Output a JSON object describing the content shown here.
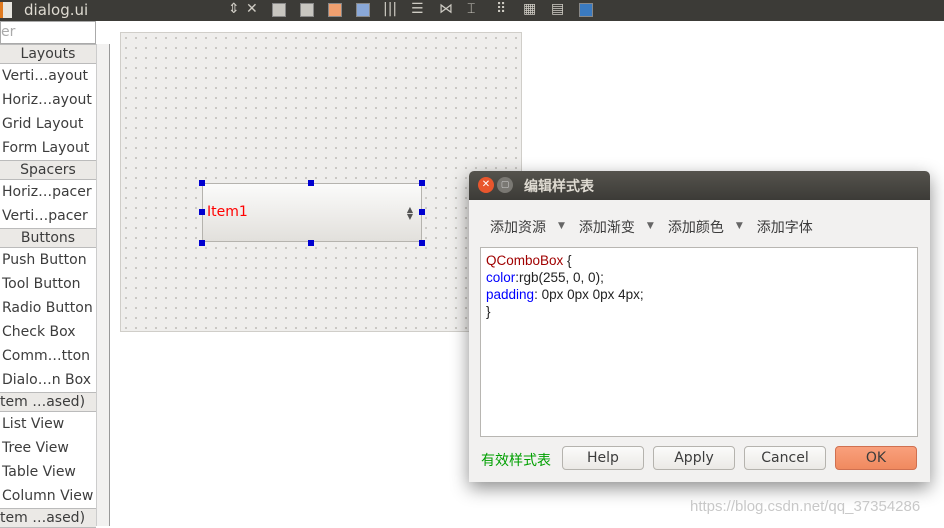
{
  "window": {
    "title": "dialog.ui"
  },
  "widget_box": {
    "filter_placeholder": "er",
    "sections": [
      {
        "header": "Layouts",
        "items": [
          "Verti…ayout",
          "Horiz…ayout",
          "Grid Layout",
          "Form Layout"
        ]
      },
      {
        "header": "Spacers",
        "items": [
          "Horiz…pacer",
          "Verti…pacer"
        ]
      },
      {
        "header": "Buttons",
        "items": [
          "Push Button",
          "Tool Button",
          "Radio Button",
          "Check Box",
          "Comm…tton",
          "Dialo…n Box"
        ]
      },
      {
        "header": "tem …ased)",
        "items": [
          "List View",
          "Tree View",
          "Table View",
          "Column View"
        ]
      },
      {
        "header": "tem …ased)",
        "items": []
      }
    ]
  },
  "form": {
    "combo_text": "Item1",
    "combo_text_color": "#ff0000"
  },
  "dialog": {
    "title": "编辑样式表",
    "tools": [
      "添加资源",
      "添加渐变",
      "添加颜色",
      "添加字体"
    ],
    "code": {
      "selector": "QComboBox",
      "open": " {",
      "prop1": "color",
      "val1": ":rgb(255, 0, 0);",
      "prop2": "padding",
      "val2": ": 0px 0px 0px 4px;",
      "close": "}"
    },
    "status": "有效样式表",
    "buttons": {
      "help": "Help",
      "apply": "Apply",
      "cancel": "Cancel",
      "ok": "OK"
    }
  },
  "watermark": "https://blog.csdn.net/qq_37354286"
}
